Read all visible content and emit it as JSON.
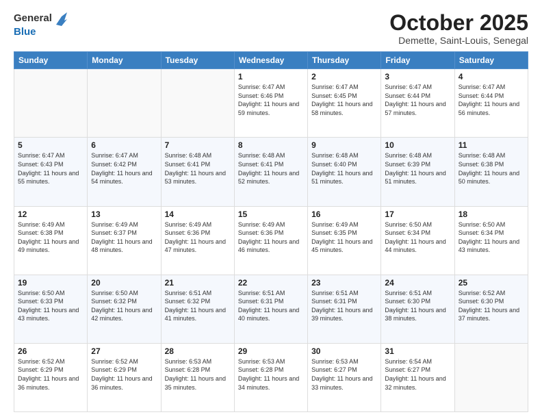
{
  "header": {
    "logo_general": "General",
    "logo_blue": "Blue",
    "month": "October 2025",
    "location": "Demette, Saint-Louis, Senegal"
  },
  "weekdays": [
    "Sunday",
    "Monday",
    "Tuesday",
    "Wednesday",
    "Thursday",
    "Friday",
    "Saturday"
  ],
  "weeks": [
    [
      {
        "day": "",
        "sunrise": "",
        "sunset": "",
        "daylight": ""
      },
      {
        "day": "",
        "sunrise": "",
        "sunset": "",
        "daylight": ""
      },
      {
        "day": "",
        "sunrise": "",
        "sunset": "",
        "daylight": ""
      },
      {
        "day": "1",
        "sunrise": "Sunrise: 6:47 AM",
        "sunset": "Sunset: 6:46 PM",
        "daylight": "Daylight: 11 hours and 59 minutes."
      },
      {
        "day": "2",
        "sunrise": "Sunrise: 6:47 AM",
        "sunset": "Sunset: 6:45 PM",
        "daylight": "Daylight: 11 hours and 58 minutes."
      },
      {
        "day": "3",
        "sunrise": "Sunrise: 6:47 AM",
        "sunset": "Sunset: 6:44 PM",
        "daylight": "Daylight: 11 hours and 57 minutes."
      },
      {
        "day": "4",
        "sunrise": "Sunrise: 6:47 AM",
        "sunset": "Sunset: 6:44 PM",
        "daylight": "Daylight: 11 hours and 56 minutes."
      }
    ],
    [
      {
        "day": "5",
        "sunrise": "Sunrise: 6:47 AM",
        "sunset": "Sunset: 6:43 PM",
        "daylight": "Daylight: 11 hours and 55 minutes."
      },
      {
        "day": "6",
        "sunrise": "Sunrise: 6:47 AM",
        "sunset": "Sunset: 6:42 PM",
        "daylight": "Daylight: 11 hours and 54 minutes."
      },
      {
        "day": "7",
        "sunrise": "Sunrise: 6:48 AM",
        "sunset": "Sunset: 6:41 PM",
        "daylight": "Daylight: 11 hours and 53 minutes."
      },
      {
        "day": "8",
        "sunrise": "Sunrise: 6:48 AM",
        "sunset": "Sunset: 6:41 PM",
        "daylight": "Daylight: 11 hours and 52 minutes."
      },
      {
        "day": "9",
        "sunrise": "Sunrise: 6:48 AM",
        "sunset": "Sunset: 6:40 PM",
        "daylight": "Daylight: 11 hours and 51 minutes."
      },
      {
        "day": "10",
        "sunrise": "Sunrise: 6:48 AM",
        "sunset": "Sunset: 6:39 PM",
        "daylight": "Daylight: 11 hours and 51 minutes."
      },
      {
        "day": "11",
        "sunrise": "Sunrise: 6:48 AM",
        "sunset": "Sunset: 6:38 PM",
        "daylight": "Daylight: 11 hours and 50 minutes."
      }
    ],
    [
      {
        "day": "12",
        "sunrise": "Sunrise: 6:49 AM",
        "sunset": "Sunset: 6:38 PM",
        "daylight": "Daylight: 11 hours and 49 minutes."
      },
      {
        "day": "13",
        "sunrise": "Sunrise: 6:49 AM",
        "sunset": "Sunset: 6:37 PM",
        "daylight": "Daylight: 11 hours and 48 minutes."
      },
      {
        "day": "14",
        "sunrise": "Sunrise: 6:49 AM",
        "sunset": "Sunset: 6:36 PM",
        "daylight": "Daylight: 11 hours and 47 minutes."
      },
      {
        "day": "15",
        "sunrise": "Sunrise: 6:49 AM",
        "sunset": "Sunset: 6:36 PM",
        "daylight": "Daylight: 11 hours and 46 minutes."
      },
      {
        "day": "16",
        "sunrise": "Sunrise: 6:49 AM",
        "sunset": "Sunset: 6:35 PM",
        "daylight": "Daylight: 11 hours and 45 minutes."
      },
      {
        "day": "17",
        "sunrise": "Sunrise: 6:50 AM",
        "sunset": "Sunset: 6:34 PM",
        "daylight": "Daylight: 11 hours and 44 minutes."
      },
      {
        "day": "18",
        "sunrise": "Sunrise: 6:50 AM",
        "sunset": "Sunset: 6:34 PM",
        "daylight": "Daylight: 11 hours and 43 minutes."
      }
    ],
    [
      {
        "day": "19",
        "sunrise": "Sunrise: 6:50 AM",
        "sunset": "Sunset: 6:33 PM",
        "daylight": "Daylight: 11 hours and 43 minutes."
      },
      {
        "day": "20",
        "sunrise": "Sunrise: 6:50 AM",
        "sunset": "Sunset: 6:32 PM",
        "daylight": "Daylight: 11 hours and 42 minutes."
      },
      {
        "day": "21",
        "sunrise": "Sunrise: 6:51 AM",
        "sunset": "Sunset: 6:32 PM",
        "daylight": "Daylight: 11 hours and 41 minutes."
      },
      {
        "day": "22",
        "sunrise": "Sunrise: 6:51 AM",
        "sunset": "Sunset: 6:31 PM",
        "daylight": "Daylight: 11 hours and 40 minutes."
      },
      {
        "day": "23",
        "sunrise": "Sunrise: 6:51 AM",
        "sunset": "Sunset: 6:31 PM",
        "daylight": "Daylight: 11 hours and 39 minutes."
      },
      {
        "day": "24",
        "sunrise": "Sunrise: 6:51 AM",
        "sunset": "Sunset: 6:30 PM",
        "daylight": "Daylight: 11 hours and 38 minutes."
      },
      {
        "day": "25",
        "sunrise": "Sunrise: 6:52 AM",
        "sunset": "Sunset: 6:30 PM",
        "daylight": "Daylight: 11 hours and 37 minutes."
      }
    ],
    [
      {
        "day": "26",
        "sunrise": "Sunrise: 6:52 AM",
        "sunset": "Sunset: 6:29 PM",
        "daylight": "Daylight: 11 hours and 36 minutes."
      },
      {
        "day": "27",
        "sunrise": "Sunrise: 6:52 AM",
        "sunset": "Sunset: 6:29 PM",
        "daylight": "Daylight: 11 hours and 36 minutes."
      },
      {
        "day": "28",
        "sunrise": "Sunrise: 6:53 AM",
        "sunset": "Sunset: 6:28 PM",
        "daylight": "Daylight: 11 hours and 35 minutes."
      },
      {
        "day": "29",
        "sunrise": "Sunrise: 6:53 AM",
        "sunset": "Sunset: 6:28 PM",
        "daylight": "Daylight: 11 hours and 34 minutes."
      },
      {
        "day": "30",
        "sunrise": "Sunrise: 6:53 AM",
        "sunset": "Sunset: 6:27 PM",
        "daylight": "Daylight: 11 hours and 33 minutes."
      },
      {
        "day": "31",
        "sunrise": "Sunrise: 6:54 AM",
        "sunset": "Sunset: 6:27 PM",
        "daylight": "Daylight: 11 hours and 32 minutes."
      },
      {
        "day": "",
        "sunrise": "",
        "sunset": "",
        "daylight": ""
      }
    ]
  ]
}
